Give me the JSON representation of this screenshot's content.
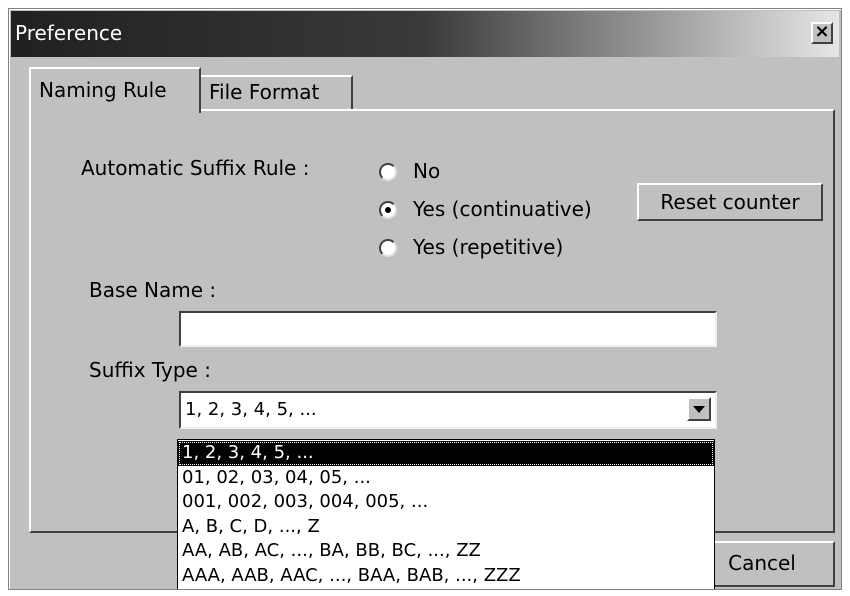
{
  "window": {
    "title": "Preference",
    "close_label": "×"
  },
  "tabs": [
    {
      "label": "Naming Rule",
      "active": true
    },
    {
      "label": "File Format",
      "active": false
    }
  ],
  "naming": {
    "suffix_rule_label": "Automatic Suffix Rule :",
    "options": [
      {
        "label": "No",
        "selected": false
      },
      {
        "label": "Yes (continuative)",
        "selected": true
      },
      {
        "label": "Yes (repetitive)",
        "selected": false
      }
    ],
    "reset_counter_label": "Reset counter",
    "base_name_label": "Base Name :",
    "base_name_value": "",
    "suffix_type_label": "Suffix Type :",
    "suffix_type_value": "1, 2, 3, 4, 5, ...",
    "suffix_type_options": [
      "1, 2, 3, 4, 5, ...",
      "01, 02, 03, 04, 05, ...",
      "001, 002, 003, 004, 005, ...",
      "A, B, C, D, ..., Z",
      "AA, AB, AC, ..., BA, BB, BC, ..., ZZ",
      "AAA, AAB, AAC, ..., BAA, BAB, ..., ZZZ"
    ],
    "suffix_type_highlighted_index": 0
  },
  "footer": {
    "cancel_label": "Cancel"
  }
}
